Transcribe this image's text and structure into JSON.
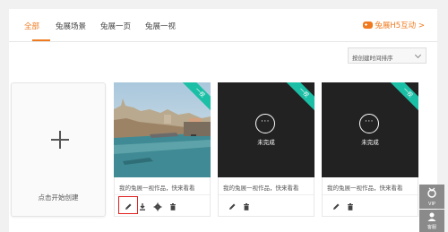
{
  "tabs": [
    {
      "label": "全部"
    },
    {
      "label": "兔展场景"
    },
    {
      "label": "兔展一页"
    },
    {
      "label": "兔展一视"
    }
  ],
  "promo": {
    "label": "兔展H5互动 >",
    "icon": "gamepad-icon"
  },
  "sort": {
    "label": "按创建时间排序"
  },
  "new_card": {
    "label": "点击开始创建"
  },
  "cards": [
    {
      "ribbon": "一视",
      "status": "",
      "description": "我的兔展一视作品，快来看看",
      "actions": [
        "edit",
        "download",
        "settings",
        "delete"
      ]
    },
    {
      "ribbon": "一视",
      "status": "未完成",
      "description": "我的兔展一视作品，快来看看",
      "actions": [
        "edit",
        "delete"
      ]
    },
    {
      "ribbon": "一视",
      "status": "未完成",
      "description": "我的兔展一视作品，快来看看",
      "actions": [
        "edit",
        "delete"
      ]
    }
  ],
  "sidebar": {
    "vip_label": "VIP",
    "help_label": "客服"
  },
  "colors": {
    "accent": "#f07a1f",
    "ribbon": "#1bbfa5",
    "highlight_box": "#e02020"
  }
}
